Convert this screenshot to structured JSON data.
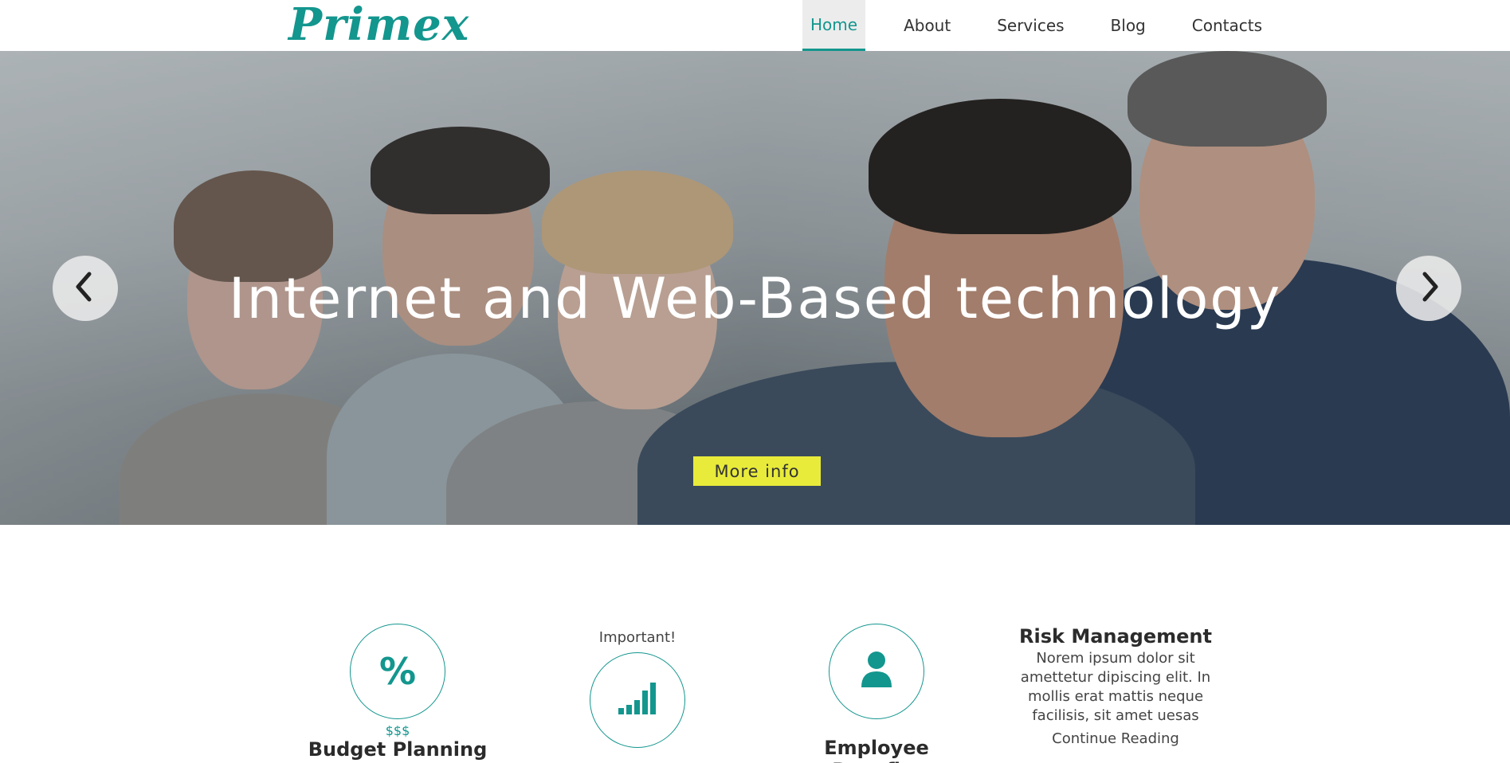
{
  "brand": {
    "logo": "Primex",
    "accent": "#13968e",
    "button_color": "#e8eb3a"
  },
  "nav": {
    "items": [
      {
        "label": "Home",
        "active": true
      },
      {
        "label": "About",
        "active": false
      },
      {
        "label": "Services",
        "active": false
      },
      {
        "label": "Blog",
        "active": false
      },
      {
        "label": "Contacts",
        "active": false
      }
    ]
  },
  "hero": {
    "title": "Internet and Web-Based technology",
    "button_label": "More info",
    "prev_icon": "chevron-left-icon",
    "next_icon": "chevron-right-icon"
  },
  "features": {
    "budget": {
      "icon": "percent-icon",
      "glyph": "%",
      "caption": "$$$",
      "title": "Budget Planning"
    },
    "important": {
      "label": "Important!",
      "icon": "signal-bars-icon"
    },
    "employee": {
      "icon": "person-icon",
      "title": "Employee Benefits"
    },
    "risk": {
      "title": "Risk Management",
      "text_lines": [
        "Norem ipsum dolor sit",
        "amettetur dipiscing elit. In",
        "mollis erat mattis neque",
        "facilisis, sit amet uesas"
      ],
      "link": "Continue Reading"
    }
  }
}
